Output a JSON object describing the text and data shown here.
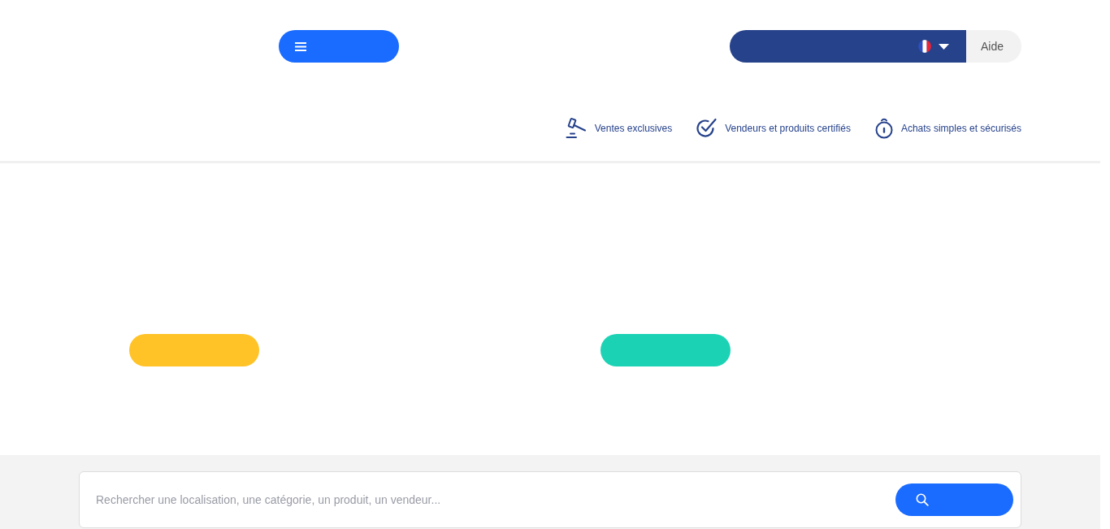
{
  "header": {
    "help_link": "Aide"
  },
  "features": [
    {
      "kind": "gavel",
      "label": "Ventes exclusives"
    },
    {
      "kind": "check",
      "label": "Vendeurs et produits certifiés"
    },
    {
      "kind": "timer",
      "label": "Achats simples et sécurisés"
    }
  ],
  "search": {
    "placeholder": "Rechercher une localisation, une catégorie, un produit, un vendeur..."
  }
}
